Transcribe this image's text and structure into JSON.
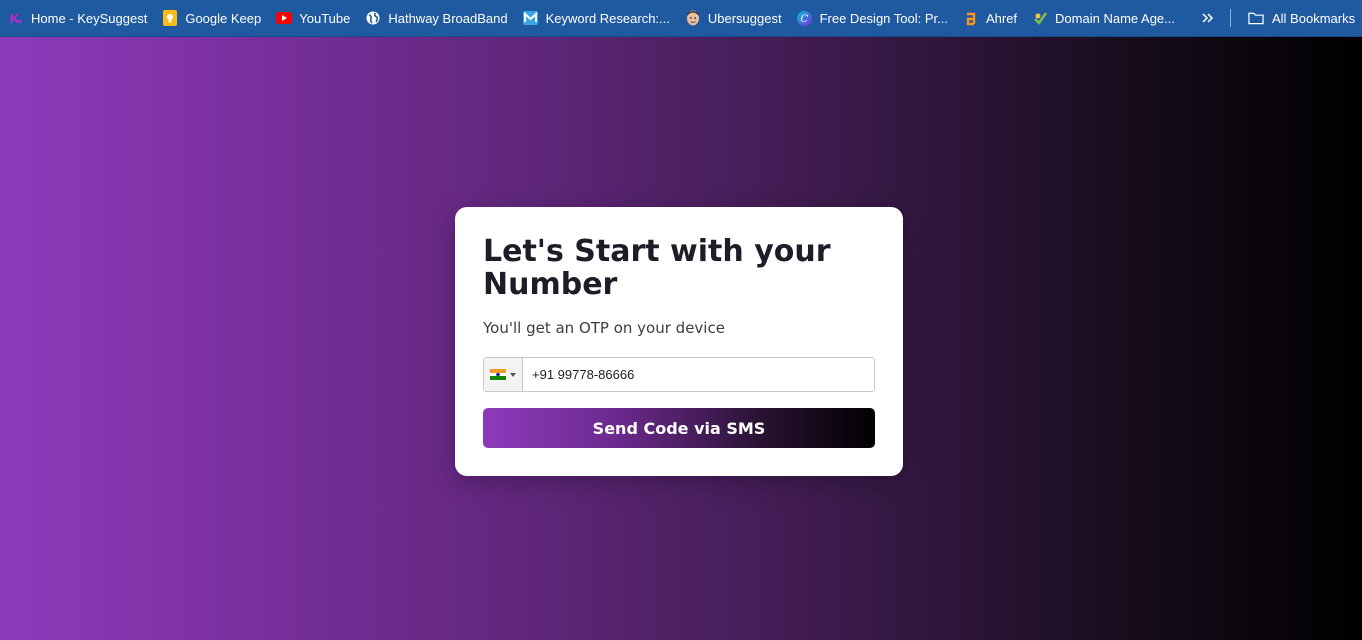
{
  "bookmarks": {
    "items": [
      {
        "label": "Home - KeySuggest",
        "icon": "keysuggest-logo-icon"
      },
      {
        "label": "Google Keep",
        "icon": "google-keep-icon"
      },
      {
        "label": "YouTube",
        "icon": "youtube-icon"
      },
      {
        "label": "Hathway BroadBand",
        "icon": "globe-icon"
      },
      {
        "label": "Keyword Research:...",
        "icon": "keyword-research-icon"
      },
      {
        "label": "Ubersuggest",
        "icon": "ubersuggest-avatar-icon"
      },
      {
        "label": "Free Design Tool: Pr...",
        "icon": "canva-icon"
      },
      {
        "label": "Ahref",
        "icon": "ahrefs-icon"
      },
      {
        "label": "Domain Name Age...",
        "icon": "domain-age-icon"
      }
    ],
    "more_icon": "chevron-double-right-icon",
    "all_bookmarks_label": "All Bookmarks",
    "all_bookmarks_icon": "folder-icon"
  },
  "card": {
    "title": "Let's Start with your Number",
    "subtitle": "You'll get an OTP on your device",
    "country_flag": "india-flag-icon",
    "phone_value": "+91 99778-86666",
    "send_button_label": "Send Code via SMS"
  },
  "colors": {
    "bookmarks_bar_bg": "#1f5aa1",
    "gradient_start": "#8e3bbb",
    "gradient_end": "#000000",
    "card_bg": "#ffffff",
    "title_color": "#1c1d27"
  }
}
